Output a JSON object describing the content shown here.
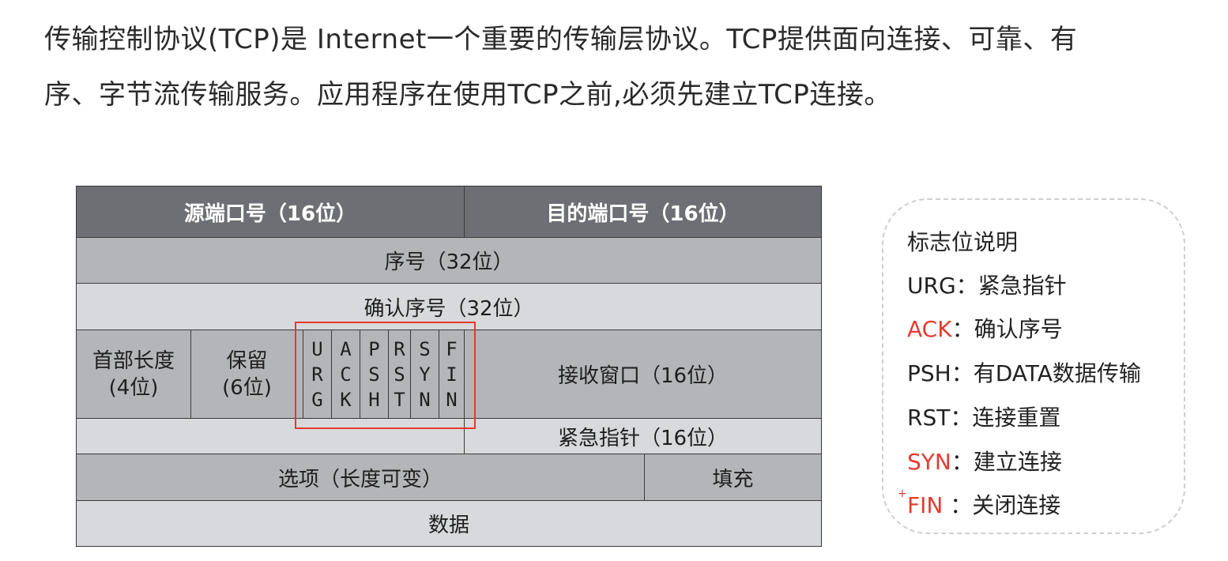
{
  "intro": {
    "line1": "传输控制协议(TCP)是 Internet一个重要的传输层协议。TCP提供面向连接、可靠、有",
    "line2": "序、字节流传输服务。应用程序在使用TCP之前,必须先建立TCP连接。"
  },
  "header": {
    "row1": {
      "src_port": "源端口号（16位）",
      "dst_port": "目的端口号（16位）"
    },
    "row2": {
      "seq": "序号（32位）"
    },
    "row3": {
      "ack_seq": "确认序号（32位）"
    },
    "row4": {
      "header_len_line1": "首部长度",
      "header_len_line2": "(4位)",
      "reserved_line1": "保留",
      "reserved_line2": "(6位)",
      "flags": [
        {
          "letters": [
            "U",
            "R",
            "G"
          ]
        },
        {
          "letters": [
            "A",
            "C",
            "K"
          ]
        },
        {
          "letters": [
            "P",
            "S",
            "H"
          ]
        },
        {
          "letters": [
            "R",
            "S",
            "T"
          ]
        },
        {
          "letters": [
            "S",
            "Y",
            "N"
          ]
        },
        {
          "letters": [
            "F",
            "I",
            "N"
          ]
        }
      ],
      "window": "接收窗口（16位）"
    },
    "row5": {
      "urgent_pointer": "紧急指针（16位）"
    },
    "row6": {
      "options": "选项（长度可变）",
      "padding": "填充"
    },
    "row7": {
      "data": "数据"
    }
  },
  "legend": {
    "title": "标志位说明",
    "items": [
      {
        "code": "URG",
        "sep": "：",
        "desc": "紧急指针",
        "highlight": false
      },
      {
        "code": "ACK",
        "sep": "：",
        "desc": "确认序号",
        "highlight": true
      },
      {
        "code": "PSH",
        "sep": "：",
        "desc": "有DATA数据传输",
        "highlight": false
      },
      {
        "code": "RST",
        "sep": "：",
        "desc": "连接重置",
        "highlight": false
      },
      {
        "code": "SYN",
        "sep": "：",
        "desc": "建立连接",
        "highlight": true
      },
      {
        "code": "FIN",
        "sep": " ：",
        "desc": "关闭连接",
        "highlight": true
      }
    ],
    "marker": "+"
  },
  "colors": {
    "header_dark": "#6e6f74",
    "header_mid": "#b4b5b9",
    "header_light": "#d8d9dc",
    "highlight_red": "#e33b2f",
    "legend_border": "#cfcfcf"
  }
}
